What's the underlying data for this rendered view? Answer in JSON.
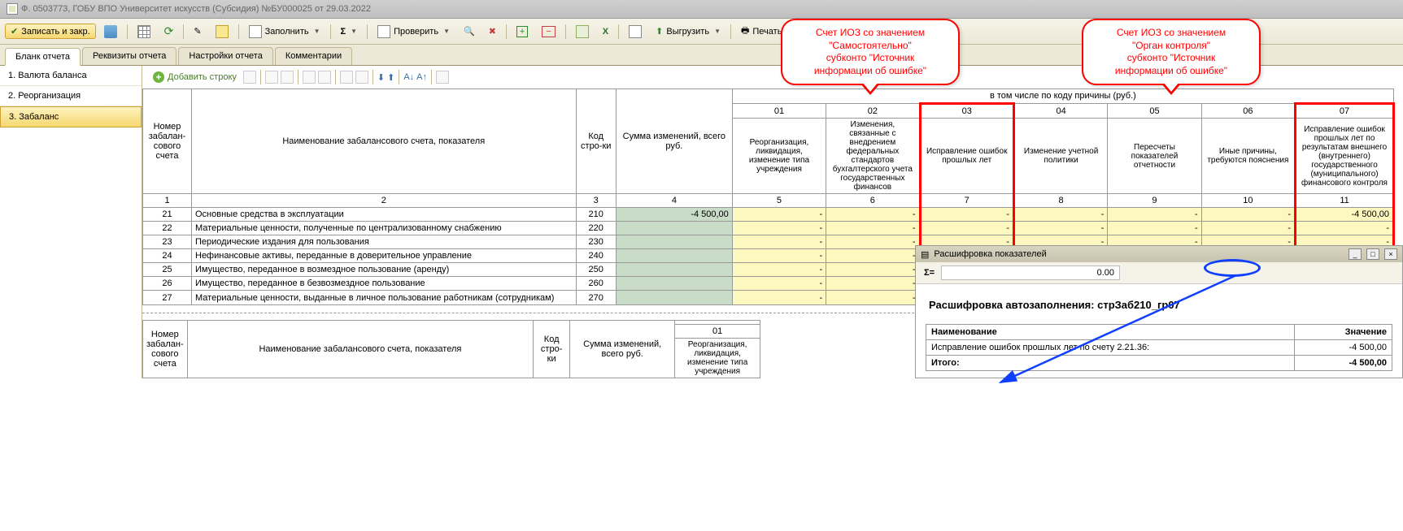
{
  "window": {
    "title": "Ф. 0503773, ГОБУ ВПО Университет искусств (Субсидия) №БУ000025 от 29.03.2022"
  },
  "toolbar": {
    "save_close": "Записать и закр.",
    "fill": "Заполнить",
    "check": "Проверить",
    "upload": "Выгрузить",
    "print": "Печать"
  },
  "tabs": {
    "blank": "Бланк отчета",
    "req": "Реквизиты отчета",
    "settings": "Настройки отчета",
    "comments": "Комментарии"
  },
  "sidebar": {
    "i1": "1. Валюта баланса",
    "i2": "2. Реорганизация",
    "i3": "3. Забаланс"
  },
  "subtoolbar": {
    "add_row": "Добавить строку"
  },
  "callout1": {
    "l1": "Счет ИОЗ со значением",
    "l2": "\"Самостоятельно\"",
    "l3": "субконто \"Источник",
    "l4": "информации об ошибке\""
  },
  "callout2": {
    "l1": "Счет ИОЗ со значением",
    "l2": "\"Орган контроля\"",
    "l3": "субконто \"Источник",
    "l4": "информации об ошибке\""
  },
  "grid": {
    "super_header": "в том числе по коду причины (руб.)",
    "h_num": "Номер забалан-сового счета",
    "h_name": "Наименование забалансового счета, показателя",
    "h_code": "Код стро-ки",
    "h_sum": "Сумма изменений, всего руб.",
    "codes": [
      "01",
      "02",
      "03",
      "04",
      "05",
      "06",
      "07"
    ],
    "sub": [
      "Реорганизация, ликвидация, изменение типа учреждения",
      "Изменения, связанные с внедрением федеральных стандартов бухгалтерского учета государственных финансов",
      "Исправление ошибок прошлых лет",
      "Изменение учетной политики",
      "Пересчеты показателей отчетности",
      "Иные причины, требуются пояснения",
      "Исправление ошибок прошлых лет по результатам внешнего (внутреннего) государственного (муниципального) финансового контроля"
    ],
    "colnums": [
      "1",
      "2",
      "3",
      "4",
      "5",
      "6",
      "7",
      "8",
      "9",
      "10",
      "11"
    ],
    "rows": [
      {
        "n": "21",
        "name": "Основные средства в эксплуатации",
        "code": "210",
        "sum": "-4 500,00",
        "v7": "-4 500,00"
      },
      {
        "n": "22",
        "name": "Материальные ценности, полученные по централизованному снабжению",
        "code": "220"
      },
      {
        "n": "23",
        "name": "Периодические издания для пользования",
        "code": "230"
      },
      {
        "n": "24",
        "name": "Нефинансовые активы, переданные в доверительное управление",
        "code": "240"
      },
      {
        "n": "25",
        "name": "Имущество, переданное в возмездное пользование (аренду)",
        "code": "250"
      },
      {
        "n": "26",
        "name": "Имущество, переданное в безвозмездное пользование",
        "code": "260"
      },
      {
        "n": "27",
        "name": "Материальные ценности, выданные в личное пользование работникам (сотрудникам)",
        "code": "270"
      }
    ]
  },
  "detail": {
    "title": "Расшифровка показателей",
    "sigma": "Σ=",
    "sigma_val": "0.00",
    "heading": "Расшифровка автозаполнения: стрЗаб210_гр07",
    "col1": "Наименование",
    "col2": "Значение",
    "row1_name": "Исправление ошибок прошлых лет по счету 2.21.36:",
    "row1_val": "-4 500,00",
    "total_name": "Итого:",
    "total_val": "-4 500,00"
  }
}
